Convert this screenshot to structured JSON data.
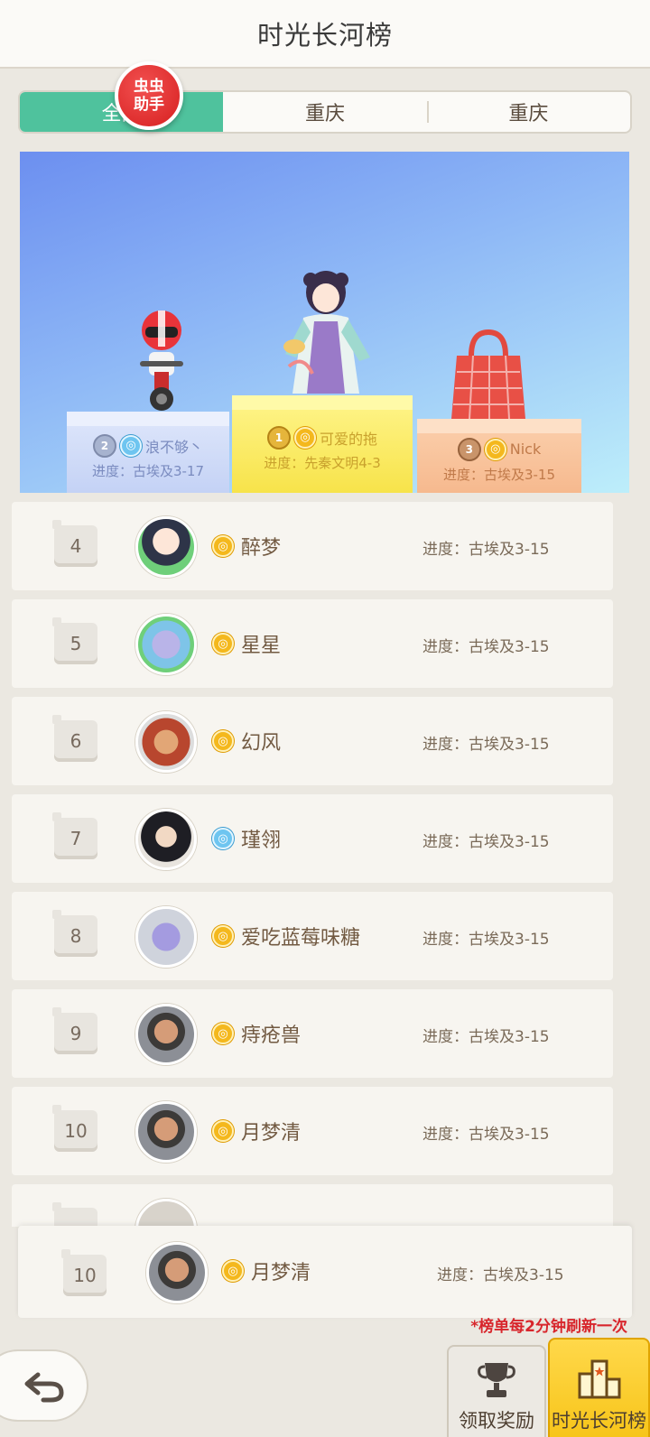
{
  "title": "时光长河榜",
  "badge": {
    "line1": "虫虫",
    "line2": "助手"
  },
  "tabs": [
    {
      "label": "全国"
    },
    {
      "label": "重庆"
    },
    {
      "label": "重庆"
    }
  ],
  "podium": {
    "first": {
      "rank": "1",
      "name": "可爱的拖",
      "progress": "进度：先秦文明4-3",
      "server_icon": "gold-coin-icon"
    },
    "second": {
      "rank": "2",
      "name": "浪不够丶",
      "progress": "进度：古埃及3-17",
      "server_icon": "blue-coin-icon"
    },
    "third": {
      "rank": "3",
      "name": "Nick",
      "progress": "进度：古埃及3-15",
      "server_icon": "gold-coin-icon"
    }
  },
  "rows": [
    {
      "rank": "4",
      "name": "醉梦",
      "progress": "进度：古埃及3-15",
      "icon": "gold-coin-icon"
    },
    {
      "rank": "5",
      "name": "星星",
      "progress": "进度：古埃及3-15",
      "icon": "gold-coin-icon"
    },
    {
      "rank": "6",
      "name": "幻风",
      "progress": "进度：古埃及3-15",
      "icon": "gold-coin-icon"
    },
    {
      "rank": "7",
      "name": "瑾翎",
      "progress": "进度：古埃及3-15",
      "icon": "blue-coin-icon"
    },
    {
      "rank": "8",
      "name": "爱吃蓝莓味糖",
      "progress": "进度：古埃及3-15",
      "icon": "gold-coin-icon"
    },
    {
      "rank": "9",
      "name": "痔疮兽",
      "progress": "进度：古埃及3-15",
      "icon": "gold-coin-icon"
    },
    {
      "rank": "10",
      "name": "月梦清",
      "progress": "进度：古埃及3-15",
      "icon": "gold-coin-icon"
    }
  ],
  "my_row": {
    "rank": "10",
    "name": "月梦清",
    "progress": "进度：古埃及3-15"
  },
  "note": "*榜单每2分钟刷新一次",
  "nav": {
    "reward_label": "领取奖励",
    "rank_label": "时光长河榜"
  },
  "colors": {
    "accent_tab": "#4fc29d",
    "rank_button": "#f7c51a",
    "note_red": "#d8262c"
  }
}
